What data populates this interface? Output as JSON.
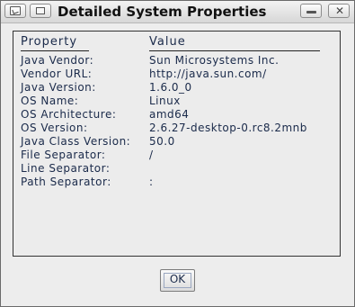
{
  "window": {
    "title": "Detailed System Properties"
  },
  "table": {
    "header_property": "Property",
    "header_value": "Value",
    "rows": [
      {
        "key": "Java Vendor:",
        "value": "Sun Microsystems Inc."
      },
      {
        "key": "Vendor URL:",
        "value": "http://java.sun.com/"
      },
      {
        "key": "Java Version:",
        "value": "1.6.0_0"
      },
      {
        "key": "OS Name:",
        "value": "Linux"
      },
      {
        "key": "OS Architecture:",
        "value": "amd64"
      },
      {
        "key": "OS Version:",
        "value": "2.6.27-desktop-0.rc8.2mnb"
      },
      {
        "key": "Java Class Version:",
        "value": "50.0"
      },
      {
        "key": "File Separator:",
        "value": "/"
      },
      {
        "key": "Line Separator:",
        "value": ""
      },
      {
        "key": "Path Separator:",
        "value": ":"
      }
    ]
  },
  "buttons": {
    "ok_label": "OK"
  },
  "icons": {
    "app": "java-app-icon",
    "menu": "window-menu-icon",
    "minimize": "minimize-icon",
    "close": "close-icon"
  }
}
